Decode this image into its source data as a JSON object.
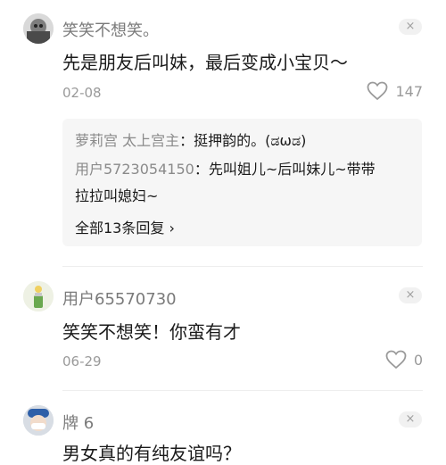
{
  "comments": [
    {
      "username": "笑笑不想笑。",
      "content": "先是朋友后叫妹，最后变成小宝贝～",
      "date": "02-08",
      "likes": "147",
      "close": "×",
      "replies": [
        {
          "user": "萝莉宫 太上宫主",
          "sep": "：",
          "text": "挺押韵的。(ಡωಡ)"
        },
        {
          "user": "用户5723054150",
          "sep": "：",
          "text": "先叫姐儿~后叫妹儿~带带",
          "text2": "拉拉叫媳妇~"
        }
      ],
      "more_replies": "全部13条回复 ›"
    },
    {
      "username": "用户65570730",
      "content": "笑笑不想笑！你蛮有才",
      "date": "06-29",
      "likes": "0",
      "close": "×"
    },
    {
      "username": "牌 6",
      "content": "男女真的有纯友谊吗？",
      "close": "×"
    }
  ]
}
